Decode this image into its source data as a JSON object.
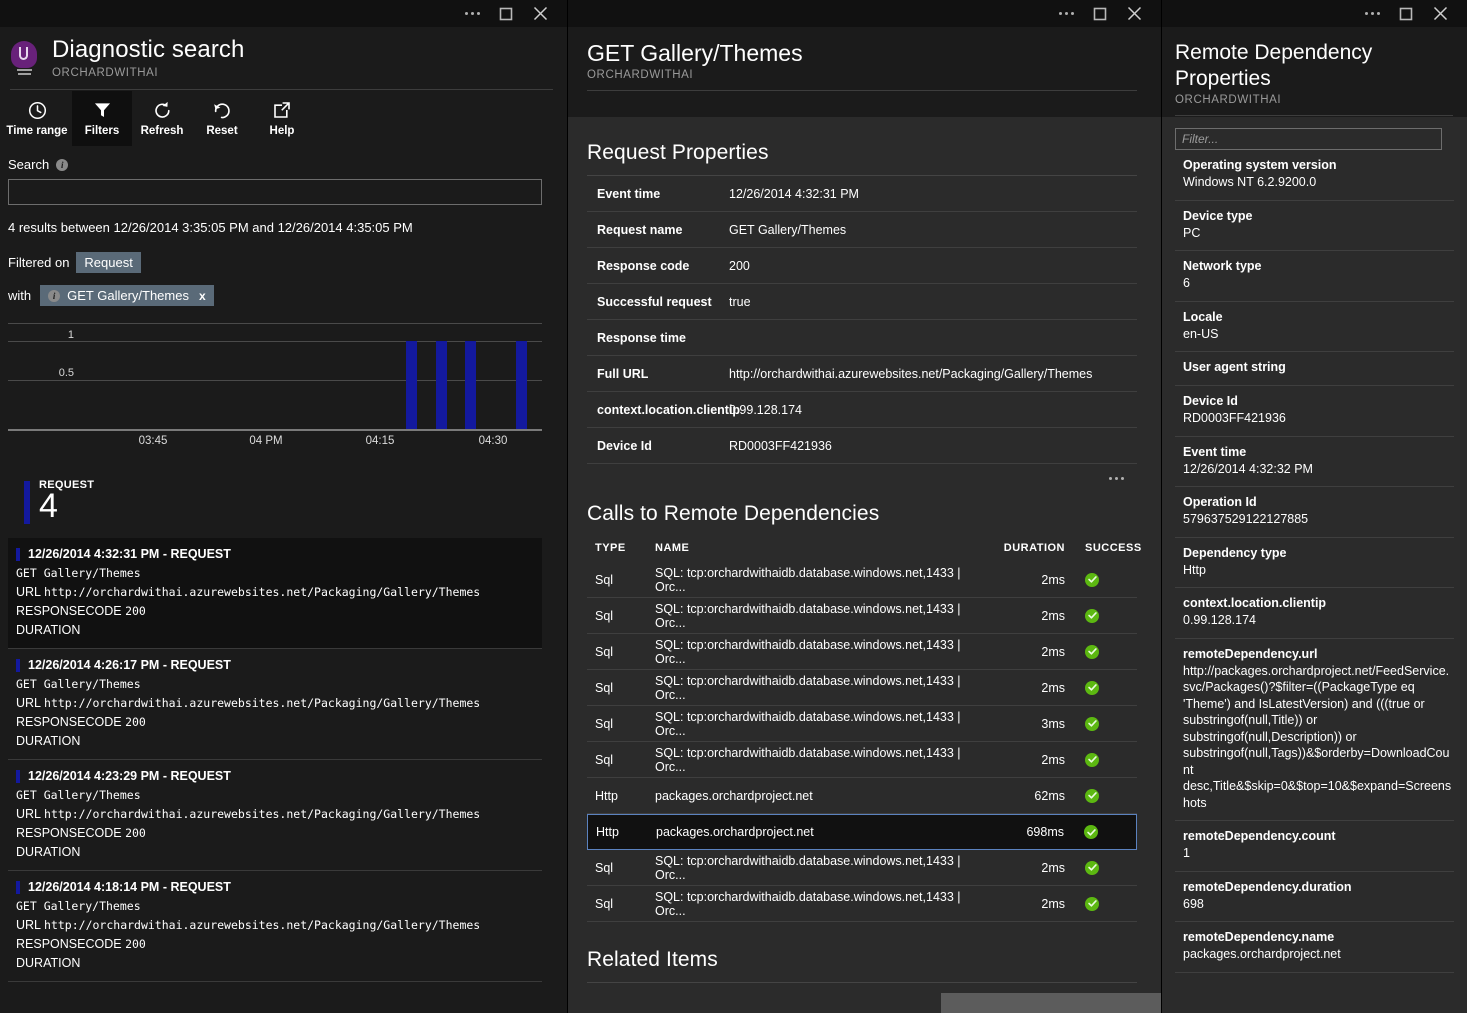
{
  "left": {
    "window": {
      "more_label": "more-options",
      "maximize_label": "maximize",
      "close_label": "close"
    },
    "title": "Diagnostic search",
    "subtitle": "ORCHARDWITHAI",
    "toolbar": [
      {
        "label": "Time range",
        "icon": "clock-icon",
        "active": false
      },
      {
        "label": "Filters",
        "icon": "funnel-icon",
        "active": true
      },
      {
        "label": "Refresh",
        "icon": "refresh-icon",
        "active": false
      },
      {
        "label": "Reset",
        "icon": "undo-icon",
        "active": false
      },
      {
        "label": "Help",
        "icon": "external-link-icon",
        "active": false
      }
    ],
    "search": {
      "label": "Search",
      "value": "",
      "placeholder": ""
    },
    "results_summary": "4 results between 12/26/2014 3:35:05 PM and 12/26/2014 4:35:05 PM",
    "filtered_on_label": "Filtered on",
    "filtered_on_value": "Request",
    "with_label": "with",
    "with_value": "GET Gallery/Themes",
    "with_remove": "x",
    "count_caption": "REQUEST",
    "count_value": "4",
    "results": [
      {
        "timestamp": "12/26/2014 4:32:31 PM - REQUEST",
        "name": "GET Gallery/Themes",
        "url_key": "URL",
        "url_value": "http://orchardwithai.azurewebsites.net/Packaging/Gallery/Themes",
        "code_key": "RESPONSECODE",
        "code_value": "200",
        "duration_key": "DURATION",
        "duration_value": "",
        "selected": true
      },
      {
        "timestamp": "12/26/2014 4:26:17 PM - REQUEST",
        "name": "GET Gallery/Themes",
        "url_key": "URL",
        "url_value": "http://orchardwithai.azurewebsites.net/Packaging/Gallery/Themes",
        "code_key": "RESPONSECODE",
        "code_value": "200",
        "duration_key": "DURATION",
        "duration_value": "",
        "selected": false
      },
      {
        "timestamp": "12/26/2014 4:23:29 PM - REQUEST",
        "name": "GET Gallery/Themes",
        "url_key": "URL",
        "url_value": "http://orchardwithai.azurewebsites.net/Packaging/Gallery/Themes",
        "code_key": "RESPONSECODE",
        "code_value": "200",
        "duration_key": "DURATION",
        "duration_value": "",
        "selected": false
      },
      {
        "timestamp": "12/26/2014 4:18:14 PM - REQUEST",
        "name": "GET Gallery/Themes",
        "url_key": "URL",
        "url_value": "http://orchardwithai.azurewebsites.net/Packaging/Gallery/Themes",
        "code_key": "RESPONSECODE",
        "code_value": "200",
        "duration_key": "DURATION",
        "duration_value": "",
        "selected": false
      }
    ]
  },
  "chart_data": {
    "type": "bar",
    "title": "",
    "xlabel": "",
    "ylabel": "",
    "ylim": [
      0,
      1.15
    ],
    "yticks": [
      "0.5",
      "1"
    ],
    "ytick_values": [
      0.5,
      1
    ],
    "grid": true,
    "legend": [
      "REQUEST"
    ],
    "series_color": "#13199e",
    "xticks": [
      "03:45",
      "04 PM",
      "04:15",
      "04:30"
    ],
    "categories": [
      "04:18",
      "04:23",
      "04:26",
      "04:32"
    ],
    "values": [
      1,
      1,
      1,
      1
    ]
  },
  "middle": {
    "title": "GET Gallery/Themes",
    "subtitle": "ORCHARDWITHAI",
    "request_properties_title": "Request Properties",
    "request_properties": [
      {
        "key": "Event time",
        "value": "12/26/2014 4:32:31 PM"
      },
      {
        "key": "Request name",
        "value": "GET Gallery/Themes"
      },
      {
        "key": "Response code",
        "value": "200"
      },
      {
        "key": "Successful request",
        "value": "true"
      },
      {
        "key": "Response time",
        "value": ""
      },
      {
        "key": "Full URL",
        "value": "http://orchardwithai.azurewebsites.net/Packaging/Gallery/Themes"
      },
      {
        "key": "context.location.clientip",
        "value": "0.99.128.174"
      },
      {
        "key": "Device Id",
        "value": "RD0003FF421936"
      }
    ],
    "more_properties_label": "...",
    "dependencies_title": "Calls to Remote Dependencies",
    "dependency_columns": [
      "TYPE",
      "NAME",
      "DURATION",
      "SUCCESS"
    ],
    "dependencies": [
      {
        "type": "Sql",
        "name": "SQL: tcp:orchardwithaidb.database.windows.net,1433 | Orc...",
        "duration": "2ms",
        "success": true,
        "selected": false
      },
      {
        "type": "Sql",
        "name": "SQL: tcp:orchardwithaidb.database.windows.net,1433 | Orc...",
        "duration": "2ms",
        "success": true,
        "selected": false
      },
      {
        "type": "Sql",
        "name": "SQL: tcp:orchardwithaidb.database.windows.net,1433 | Orc...",
        "duration": "2ms",
        "success": true,
        "selected": false
      },
      {
        "type": "Sql",
        "name": "SQL: tcp:orchardwithaidb.database.windows.net,1433 | Orc...",
        "duration": "2ms",
        "success": true,
        "selected": false
      },
      {
        "type": "Sql",
        "name": "SQL: tcp:orchardwithaidb.database.windows.net,1433 | Orc...",
        "duration": "3ms",
        "success": true,
        "selected": false
      },
      {
        "type": "Sql",
        "name": "SQL: tcp:orchardwithaidb.database.windows.net,1433 | Orc...",
        "duration": "2ms",
        "success": true,
        "selected": false
      },
      {
        "type": "Http",
        "name": "packages.orchardproject.net",
        "duration": "62ms",
        "success": true,
        "selected": false
      },
      {
        "type": "Http",
        "name": "packages.orchardproject.net",
        "duration": "698ms",
        "success": true,
        "selected": true
      },
      {
        "type": "Sql",
        "name": "SQL: tcp:orchardwithaidb.database.windows.net,1433 | Orc...",
        "duration": "2ms",
        "success": true,
        "selected": false
      },
      {
        "type": "Sql",
        "name": "SQL: tcp:orchardwithaidb.database.windows.net,1433 | Orc...",
        "duration": "2ms",
        "success": true,
        "selected": false
      }
    ],
    "related_items_title": "Related Items"
  },
  "right": {
    "title": "Remote Dependency Properties",
    "subtitle": "ORCHARDWITHAI",
    "filter_placeholder": "Filter...",
    "filter_value": "",
    "properties": [
      {
        "key": "Operating system version",
        "value": "Windows NT 6.2.9200.0"
      },
      {
        "key": "Device type",
        "value": "PC"
      },
      {
        "key": "Network type",
        "value": "6"
      },
      {
        "key": "Locale",
        "value": "en-US"
      },
      {
        "key": "User agent string",
        "value": ""
      },
      {
        "key": "Device Id",
        "value": "RD0003FF421936"
      },
      {
        "key": "Event time",
        "value": "12/26/2014 4:32:32 PM"
      },
      {
        "key": "Operation Id",
        "value": "579637529122127885"
      },
      {
        "key": "Dependency type",
        "value": "Http"
      },
      {
        "key": "context.location.clientip",
        "value": "0.99.128.174"
      },
      {
        "key": "remoteDependency.url",
        "value": "http://packages.orchardproject.net/FeedService.svc/Packages()?$filter=((PackageType eq 'Theme') and IsLatestVersion) and (((true or substringof(null,Title)) or substringof(null,Description)) or substringof(null,Tags))&$orderby=DownloadCount desc,Title&$skip=0&$top=10&$expand=Screenshots"
      },
      {
        "key": "remoteDependency.count",
        "value": "1"
      },
      {
        "key": "remoteDependency.duration",
        "value": "698"
      },
      {
        "key": "remoteDependency.name",
        "value": "packages.orchardproject.net"
      }
    ]
  },
  "colors": {
    "accent_bar": "#13199e",
    "success_green": "#5cb811",
    "pill_bg": "#5a6a78",
    "selection_border": "#5b82bf",
    "brand_purple": "#68217a"
  }
}
